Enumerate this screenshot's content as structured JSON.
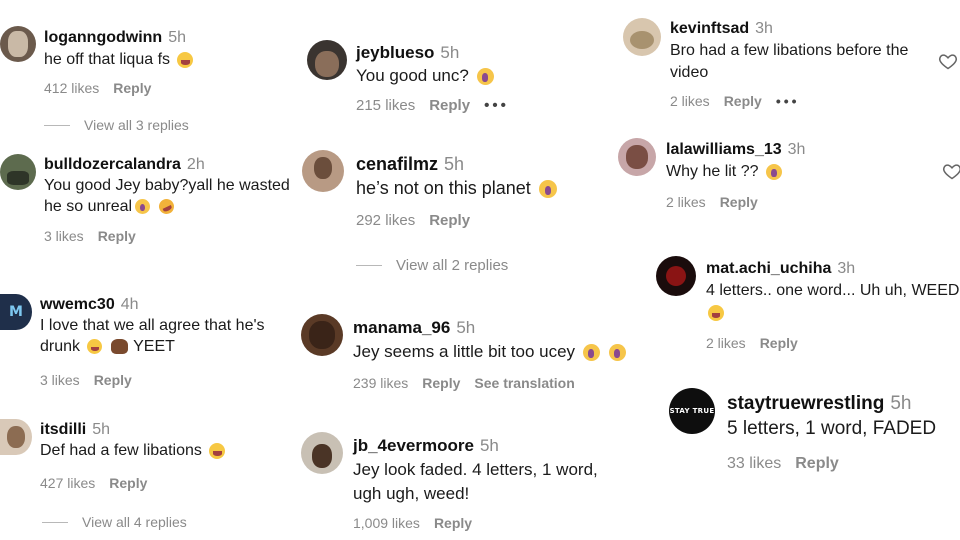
{
  "columns": [
    {
      "comments": [
        {
          "username": "loganngodwinn",
          "time": "5h",
          "lines": [
            "he off that liqua fs"
          ],
          "emoji": [
            "laugh"
          ],
          "likes": "412 likes",
          "reply": "Reply"
        },
        {
          "username": "bulldozercalandra",
          "time": "2h",
          "lines": [
            "You good Jey baby?yall he wasted",
            "he so unreal"
          ],
          "emoji": [
            "cry",
            "rofl"
          ],
          "likes": "3 likes",
          "reply": "Reply"
        },
        {
          "username": "wwemc30",
          "time": "4h",
          "lines": [
            "I love that we all agree that he's",
            "drunk",
            "YEET"
          ],
          "emoji": [
            "laugh",
            "hands"
          ],
          "likes": "3 likes",
          "reply": "Reply"
        },
        {
          "username": "itsdilli",
          "time": "5h",
          "lines": [
            "Def had a few libations"
          ],
          "emoji": [
            "laugh"
          ],
          "likes": "427 likes",
          "reply": "Reply"
        }
      ],
      "view_replies": [
        "View all 3 replies",
        "View all 4 replies"
      ]
    },
    {
      "comments": [
        {
          "username": "jeyblueso",
          "time": "5h",
          "lines": [
            "You good unc?"
          ],
          "emoji": [
            "cry"
          ],
          "likes": "215 likes",
          "reply": "Reply",
          "more": "•••"
        },
        {
          "username": "cenafilmz",
          "time": "5h",
          "lines": [
            "he’s not on this planet"
          ],
          "emoji": [
            "cry"
          ],
          "likes": "292 likes",
          "reply": "Reply"
        },
        {
          "username": "manama_96",
          "time": "5h",
          "lines": [
            "Jey seems a little bit too ucey"
          ],
          "emoji": [
            "cry",
            "cry"
          ],
          "likes": "239 likes",
          "reply": "Reply",
          "translate": "See translation"
        },
        {
          "username": "jb_4evermoore",
          "time": "5h",
          "lines": [
            "Jey look faded. 4 letters, 1 word,",
            "ugh ugh, weed!"
          ],
          "emoji": [],
          "likes": "1,009 likes",
          "reply": "Reply"
        }
      ],
      "view_replies": [
        "View all 2 replies"
      ]
    },
    {
      "comments": [
        {
          "username": "kevinftsad",
          "time": "3h",
          "lines": [
            "Bro had a few libations before the",
            "video"
          ],
          "emoji": [],
          "likes": "2 likes",
          "reply": "Reply",
          "more": "•••"
        },
        {
          "username": "lalawilliams_13",
          "time": "3h",
          "lines": [
            "Why he lit ??"
          ],
          "emoji": [
            "cry"
          ],
          "likes": "2 likes",
          "reply": "Reply"
        },
        {
          "username": "mat.achi_uchiha",
          "time": "3h",
          "lines": [
            "4 letters.. one word... Uh uh, WEED"
          ],
          "emoji": [
            "laugh"
          ],
          "likes": "2 likes",
          "reply": "Reply"
        },
        {
          "username": "staytruewrestling",
          "time": "5h",
          "lines": [
            "5 letters, 1 word, FADED"
          ],
          "emoji": [],
          "likes": "33 likes",
          "reply": "Reply",
          "avatar_text": "STAY TRUE"
        }
      ]
    }
  ],
  "icons": {
    "heart": "heart-icon",
    "more": "more-options-icon"
  },
  "colors": {
    "text": "#1b1b1b",
    "muted": "#8a8a8a",
    "background": "#ffffff"
  }
}
